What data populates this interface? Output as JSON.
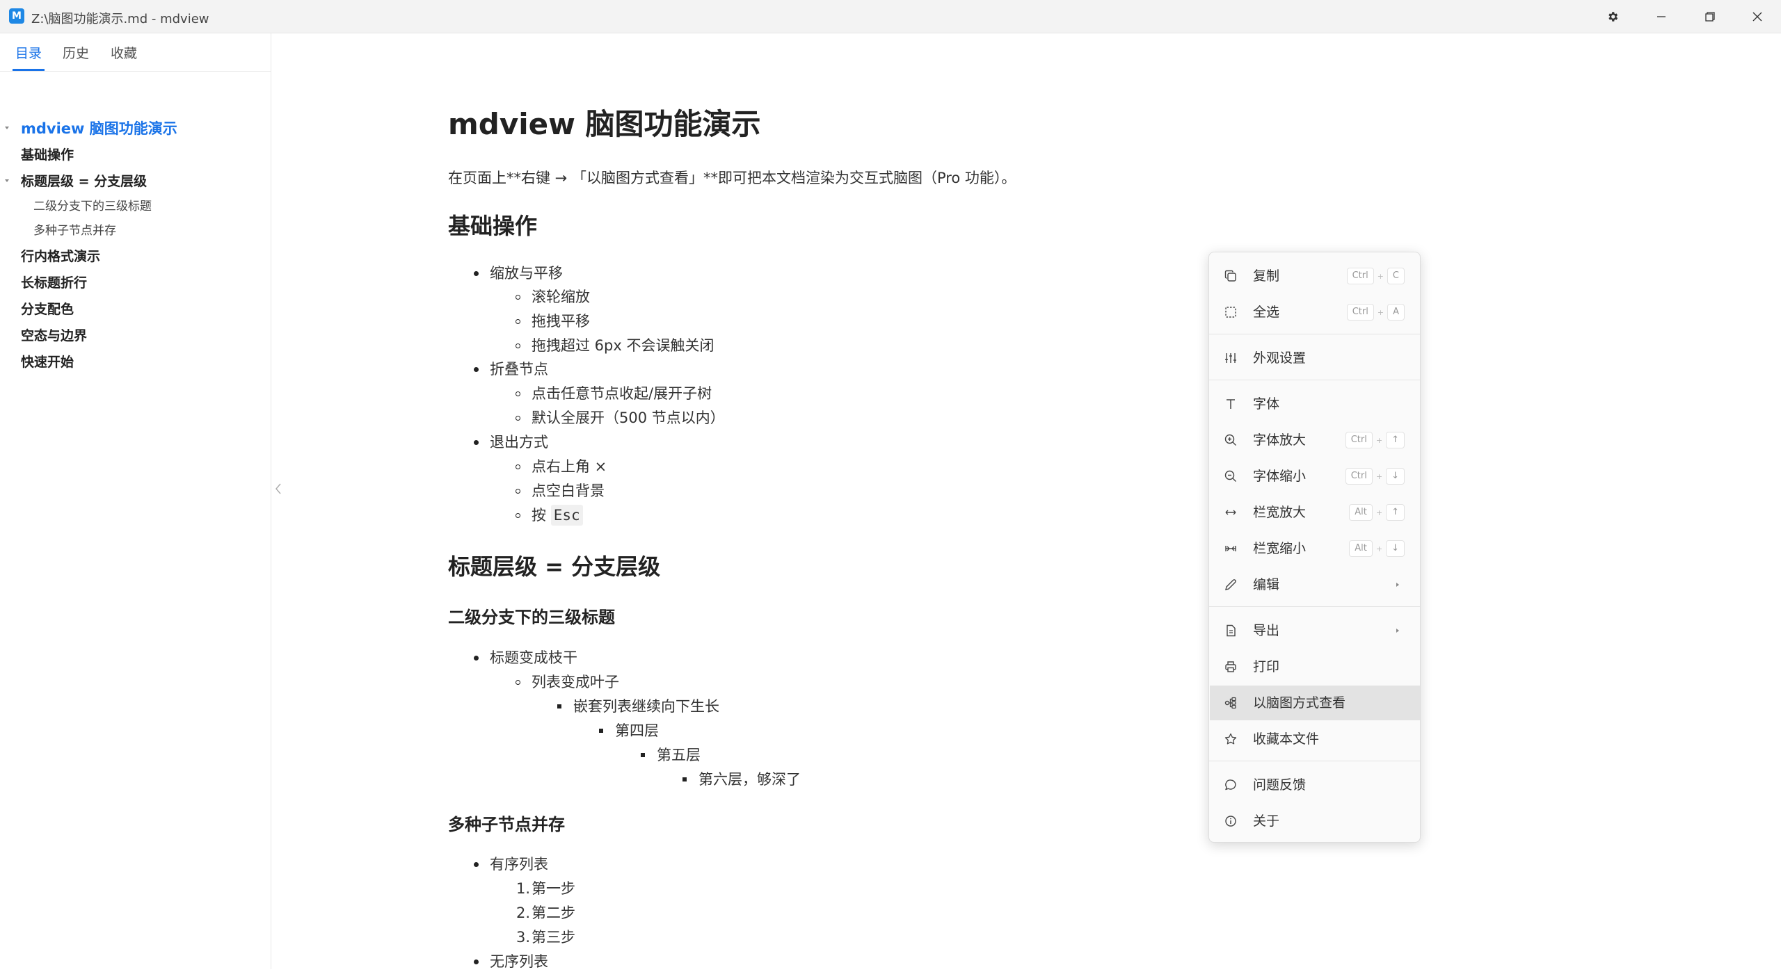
{
  "window": {
    "title": "Z:\\脑图功能演示.md - mdview",
    "app_icon_letter": "M"
  },
  "sidebar": {
    "tabs": [
      {
        "label": "目录",
        "active": true
      },
      {
        "label": "历史",
        "active": false
      },
      {
        "label": "收藏",
        "active": false
      }
    ],
    "toc": [
      {
        "label": "mdview 脑图功能演示",
        "level": 1,
        "collapsible": true
      },
      {
        "label": "基础操作",
        "level": 2
      },
      {
        "label": "标题层级 = 分支层级",
        "level": 2,
        "collapsible": true
      },
      {
        "label": "二级分支下的三级标题",
        "level": 3
      },
      {
        "label": "多种子节点并存",
        "level": 3
      },
      {
        "label": "行内格式演示",
        "level": 2
      },
      {
        "label": "长标题折行",
        "level": 2
      },
      {
        "label": "分支配色",
        "level": 2
      },
      {
        "label": "空态与边界",
        "level": 2
      },
      {
        "label": "快速开始",
        "level": 2
      }
    ]
  },
  "document": {
    "title": "mdview 脑图功能演示",
    "intro": "在页面上**右键 → 「以脑图方式查看」**即可把本文档渲染为交互式脑图（Pro 功能）。",
    "sections": {
      "basic_heading": "基础操作",
      "basic_items": [
        "缩放与平移",
        "滚轮缩放",
        "拖拽平移",
        "拖拽超过 6px 不会误触关闭",
        "折叠节点",
        "点击任意节点收起/展开子树",
        "默认全展开（500 节点以内）",
        "退出方式",
        "点右上角 ×",
        "点空白背景",
        "按 ",
        "Esc"
      ],
      "levels_heading": "标题层级 = 分支层级",
      "levels_sub_heading": "二级分支下的三级标题",
      "levels_items": [
        "标题变成枝干",
        "列表变成叶子",
        "嵌套列表继续向下生长",
        "第四层",
        "第五层",
        "第六层，够深了"
      ],
      "multi_heading": "多种子节点并存",
      "multi_items": [
        "有序列表",
        "第一步",
        "第二步",
        "第三步",
        "无序列表"
      ],
      "ordered_numbers": [
        "1.",
        "2.",
        "3."
      ]
    }
  },
  "context_menu": {
    "items": [
      {
        "label": "复制",
        "icon": "copy-icon",
        "shortcut": [
          "Ctrl",
          "C"
        ]
      },
      {
        "label": "全选",
        "icon": "select-all-icon",
        "shortcut": [
          "Ctrl",
          "A"
        ]
      },
      {
        "label": "外观设置",
        "icon": "sliders-icon"
      },
      {
        "label": "字体",
        "icon": "font-icon"
      },
      {
        "label": "字体放大",
        "icon": "zoom-in-icon",
        "shortcut": [
          "Ctrl",
          "↑"
        ]
      },
      {
        "label": "字体缩小",
        "icon": "zoom-out-icon",
        "shortcut": [
          "Ctrl",
          "↓"
        ]
      },
      {
        "label": "栏宽放大",
        "icon": "widen-icon",
        "shortcut": [
          "Alt",
          "↑"
        ]
      },
      {
        "label": "栏宽缩小",
        "icon": "narrow-icon",
        "shortcut": [
          "Alt",
          "↓"
        ]
      },
      {
        "label": "编辑",
        "icon": "pencil-icon",
        "submenu": true
      },
      {
        "label": "导出",
        "icon": "export-doc-icon",
        "submenu": true
      },
      {
        "label": "打印",
        "icon": "printer-icon"
      },
      {
        "label": "以脑图方式查看",
        "icon": "mindmap-icon",
        "highlighted": true
      },
      {
        "label": "收藏本文件",
        "icon": "star-icon"
      },
      {
        "label": "问题反馈",
        "icon": "chat-bubble-icon"
      },
      {
        "label": "关于",
        "icon": "info-icon"
      }
    ],
    "plus_sign": "+"
  }
}
